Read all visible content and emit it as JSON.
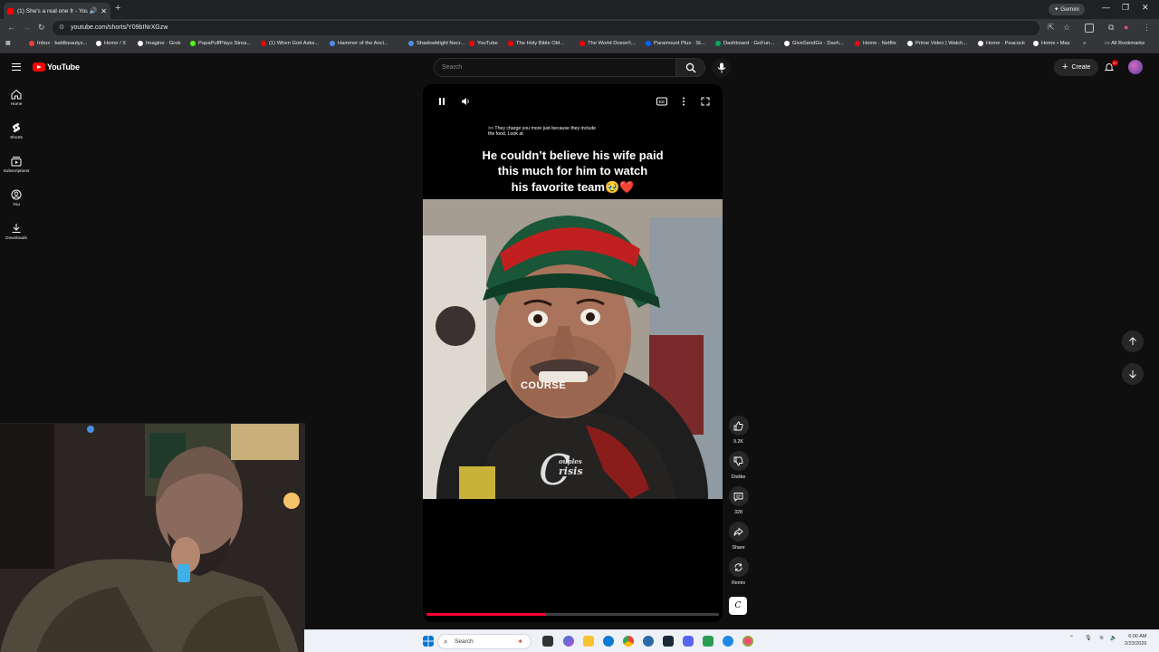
{
  "browser": {
    "tab_title": "(1) She's a real one fr - You",
    "new_tab": "+",
    "gemini": "Gemini",
    "url": "youtube.com/shorts/Y09bINrXGzw",
    "bookmarks": [
      {
        "label": "Inbox · baldbeautyz...",
        "color": "#ea4335"
      },
      {
        "label": "Home / X",
        "color": "#ffffff"
      },
      {
        "label": "Imagine · Grok",
        "color": "#ffffff"
      },
      {
        "label": "PapaPuffPlays Strea...",
        "color": "#53fc18"
      },
      {
        "label": "(1) When God Asks...",
        "color": "#ff0000"
      },
      {
        "label": "Hammer of the Anci...",
        "color": "#4a90e2"
      },
      {
        "label": "Shadowblight Necr...",
        "color": "#4a90e2"
      },
      {
        "label": "YouTube",
        "color": "#ff0000"
      },
      {
        "label": "The Holy Bible Old...",
        "color": "#ff0000"
      },
      {
        "label": "The World Doesn't...",
        "color": "#ff0000"
      },
      {
        "label": "Paramount Plus · St...",
        "color": "#0064ff"
      },
      {
        "label": "Dashboard · GoFun...",
        "color": "#02a95c"
      },
      {
        "label": "GiveSendGo · Dash...",
        "color": "#ffffff"
      },
      {
        "label": "Home · Netflix",
        "color": "#e50914"
      },
      {
        "label": "Prime Video | Watch...",
        "color": "#ffffff"
      },
      {
        "label": "Home · Peacock",
        "color": "#ffffff"
      },
      {
        "label": "Home • Max",
        "color": "#ffffff"
      }
    ],
    "all_bookmarks": "All Bookmarks"
  },
  "youtube": {
    "logo_text": "YouTube",
    "search_placeholder": "Search",
    "create_label": "Create",
    "notification_count": "9+",
    "nav": [
      {
        "label": "Home",
        "icon": "home-icon"
      },
      {
        "label": "Shorts",
        "icon": "shorts-icon"
      },
      {
        "label": "Subscriptions",
        "icon": "subscriptions-icon"
      },
      {
        "label": "You",
        "icon": "you-icon"
      },
      {
        "label": "Downloads",
        "icon": "downloads-icon"
      }
    ]
  },
  "short": {
    "top_caption": ">> They charge you more just because they include the food. Look at",
    "headline_line1": "He couldn’t believe his wife paid",
    "headline_line2": "this much for him to watch",
    "headline_line3": "his favorite team🥹❤️",
    "subtitle_word": "COURSE",
    "watermark_big": "C",
    "watermark_small1": "ouples",
    "watermark_small2": "risis",
    "progress": 0.41,
    "actions": [
      {
        "name": "like",
        "label": "9.2K"
      },
      {
        "name": "dislike",
        "label": "Dislike"
      },
      {
        "name": "comments",
        "label": "328"
      },
      {
        "name": "share",
        "label": "Share"
      },
      {
        "name": "remix",
        "label": "Remix"
      }
    ],
    "channel_glyph": "C"
  },
  "taskbar": {
    "search_label": "Search",
    "time": "6:00 AM",
    "date": "2/23/2026"
  }
}
